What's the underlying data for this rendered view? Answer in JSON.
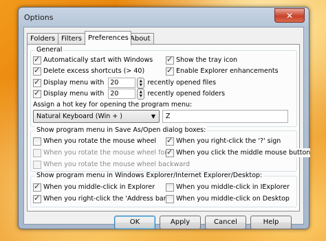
{
  "window": {
    "title": "Options",
    "close_glyph": "✕"
  },
  "tabs": [
    {
      "label": "Folders",
      "active": false
    },
    {
      "label": "Filters",
      "active": false
    },
    {
      "label": "Preferences",
      "active": true
    },
    {
      "label": "About",
      "active": false
    }
  ],
  "general": {
    "label": "General",
    "auto_start": {
      "label": "Automatically start with Windows",
      "checked": true
    },
    "delete_excess": {
      "label": "Delete excess shortcuts (> 40)",
      "checked": true
    },
    "display_files": {
      "label_pre": "Display menu with",
      "value": "20",
      "label_post": "recently opened files",
      "checked": true
    },
    "display_folders": {
      "label_pre": "Display menu with",
      "value": "20",
      "label_post": "recently opened folders",
      "checked": true
    },
    "show_tray": {
      "label": "Show the tray icon",
      "checked": true
    },
    "explorer_enh": {
      "label": "Enable Explorer enhancements",
      "checked": true
    },
    "hotkey_label": "Assign a hot key for opening the program menu:",
    "hotkey_select": "Natural Keyboard (Win + )",
    "hotkey_key": "Z"
  },
  "saveas": {
    "label": "Show program menu in Save As/Open dialog boxes:",
    "wheel": {
      "label": "When you rotate the mouse wheel",
      "checked": false,
      "disabled": false
    },
    "wheel_forward": {
      "label": "When you rotate the mouse wheel forward",
      "checked": false,
      "disabled": true
    },
    "wheel_backward": {
      "label": "When you rotate the mouse wheel backward",
      "checked": false,
      "disabled": true
    },
    "right_click_q": {
      "label": "When you right-click the '?' sign",
      "checked": true
    },
    "middle_button": {
      "label": "When you click the middle mouse button",
      "checked": true
    }
  },
  "explorer": {
    "label": "Show program menu in Windows Explorer/Internet Explorer/Desktop:",
    "middle_explorer": {
      "label": "When you middle-click in Explorer",
      "checked": true
    },
    "right_address": {
      "label": "When you right-click the 'Address bar'",
      "checked": true
    },
    "middle_iexplorer": {
      "label": "When you middle-click in IExplorer",
      "checked": false
    },
    "middle_desktop": {
      "label": "When you middle-click on Desktop",
      "checked": false
    }
  },
  "buttons": {
    "ok": "OK",
    "apply": "Apply",
    "cancel": "Cancel",
    "help": "Help"
  }
}
